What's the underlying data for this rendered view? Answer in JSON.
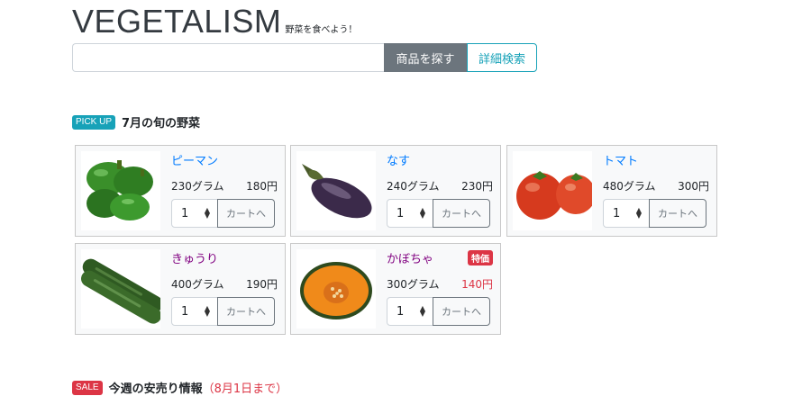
{
  "header": {
    "logo": "VEGETALISM",
    "tagline": "野菜を食べよう！"
  },
  "search": {
    "value": "",
    "placeholder": "",
    "search_button": "商品を探す",
    "advanced_button": "詳細検索"
  },
  "pickup": {
    "badge": "PICK UP",
    "title": "7月の旬の野菜"
  },
  "products": [
    {
      "name": "ピーマン",
      "weight": "230グラム",
      "price": "180円",
      "qty": "1",
      "cart_label": "カートへ",
      "image": "green-pepper"
    },
    {
      "name": "なす",
      "weight": "240グラム",
      "price": "230円",
      "qty": "1",
      "cart_label": "カートへ",
      "image": "eggplant"
    },
    {
      "name": "トマト",
      "weight": "480グラム",
      "price": "300円",
      "qty": "1",
      "cart_label": "カートへ",
      "image": "tomato"
    },
    {
      "name": "きゅうり",
      "weight": "400グラム",
      "price": "190円",
      "qty": "1",
      "cart_label": "カートへ",
      "image": "cucumber"
    },
    {
      "name": "かぼちゃ",
      "weight": "300グラム",
      "price": "140円",
      "qty": "1",
      "cart_label": "カートへ",
      "image": "pumpkin",
      "special": "特価"
    }
  ],
  "sale": {
    "badge": "SALE",
    "title": "今週の安売り情報",
    "note": "（8月1日まで）"
  },
  "colors": {
    "link": "#007bff",
    "visited": "#800080",
    "accent": "#17a2b8",
    "danger": "#dc3545",
    "search_button": "#6c757d"
  }
}
